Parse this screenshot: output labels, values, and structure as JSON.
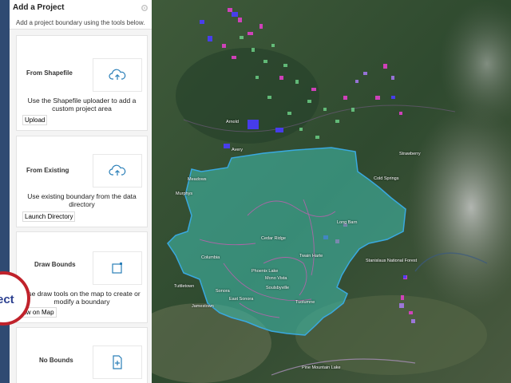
{
  "panel": {
    "title": "Add a Project",
    "subtitle": "Add a project boundary using the tools below.",
    "collapse_icon": "chevron-left-icon"
  },
  "cards": [
    {
      "title": "From Shapefile",
      "icon": "cloud-upload-icon",
      "description": "Use the Shapefile uploader to add a custom project area",
      "button": "Upload"
    },
    {
      "title": "From Existing",
      "icon": "cloud-upload-icon",
      "description": "Use existing boundary from the data directory",
      "button": "Launch Directory"
    },
    {
      "title": "Draw Bounds",
      "icon": "draw-square-icon",
      "description": "Use draw tools on the map to create or modify a boundary",
      "button": "Draw on Map"
    },
    {
      "title": "No Bounds",
      "icon": "add-file-icon",
      "description": "",
      "button": ""
    }
  ],
  "badge": {
    "text": "ect"
  },
  "map": {
    "labels": [
      "Arnold",
      "Avery",
      "Strawberry",
      "Cold Springs",
      "Meadows",
      "Murphys",
      "Cedar Ridge",
      "Twain Harte",
      "Columbia",
      "Phoenix Lake",
      "Mono Vista",
      "Sonora",
      "Soulsbyville",
      "East Sonora",
      "Tuolumne",
      "Jamestown",
      "Tuttletown",
      "Stanislaus National Forest",
      "Long Barn",
      "Pine Mountain Lake"
    ],
    "colors": {
      "boundary_fill": "#3fb8a6",
      "boundary_stroke": "#39a9e0",
      "parcel_pink": "#e040c8",
      "parcel_blue": "#4a3cff",
      "parcel_green": "#6fd68a"
    }
  }
}
